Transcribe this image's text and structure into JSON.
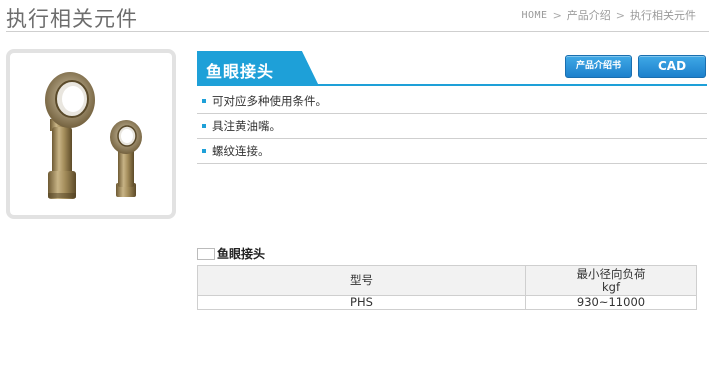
{
  "page": {
    "title": "执行相关元件"
  },
  "breadcrumb": {
    "home": "HOME",
    "separator": ">",
    "items": [
      "产品介绍",
      "执行相关元件"
    ]
  },
  "product": {
    "name": "鱼眼接头",
    "image_icon": "rod-end-bearing-photo",
    "buttons": {
      "intro": "产品介绍书",
      "cad": "CAD"
    },
    "features": [
      "可对应多种使用条件。",
      "具注黄油嘴。",
      "螺纹连接。"
    ]
  },
  "spec_section": {
    "heading": "鱼眼接头",
    "columns": [
      "型号",
      "最小径向负荷",
      "kgf"
    ],
    "rows": [
      {
        "model": "PHS",
        "load": "930~11000"
      }
    ]
  },
  "colors": {
    "accent": "#1ea0d8",
    "button": "#2a8fd8",
    "title_text": "#6d6d6d"
  }
}
